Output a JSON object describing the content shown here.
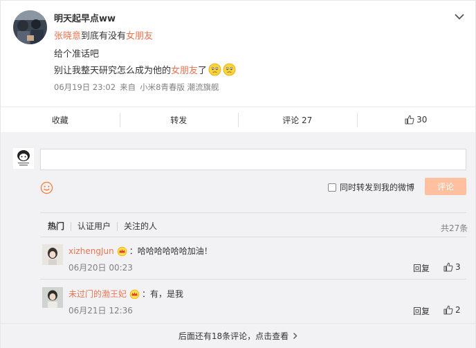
{
  "post": {
    "author": "明天起早点ww",
    "mention": "张晓意",
    "line1_middle": "到底有没有",
    "line1_tag": "女朋友",
    "line2": "给个准话吧",
    "line3_before": "别让我整天研究怎么成为他的",
    "line3_tag": "女朋友",
    "line3_after": "了",
    "emojis": [
      "sad-face-emoji",
      "sad-face-emoji"
    ],
    "meta": {
      "date": "06月19日 23:02",
      "source_prefix": "来自",
      "source": "小米8青春版 潮流旗舰"
    }
  },
  "actions": {
    "favorite": "收藏",
    "repost": "转发",
    "comment": "评论 27",
    "like_count": "30"
  },
  "composer": {
    "placeholder": "",
    "repost_checkbox_label": "同时转发到我的微博",
    "submit_label": "评论"
  },
  "comment_tabs": {
    "items": [
      "热门",
      "认证用户",
      "关注的人"
    ],
    "total": "共27条"
  },
  "comments": [
    {
      "name": "xizhengJun",
      "text": "：哈哈哈哈哈哈加油！",
      "time": "06月20日 00:23",
      "reply": "回复",
      "likes": "3"
    },
    {
      "name": "未过门的渤王妃",
      "text": "：有，是我",
      "time": "06月21日 12:36",
      "reply": "回复",
      "likes": "2"
    }
  ],
  "more_comments": "后面还有18条评论，点击查看",
  "colors": {
    "accent": "#eb7350",
    "submit_disabled": "#ffc09f",
    "background": "#f2f2f5"
  }
}
